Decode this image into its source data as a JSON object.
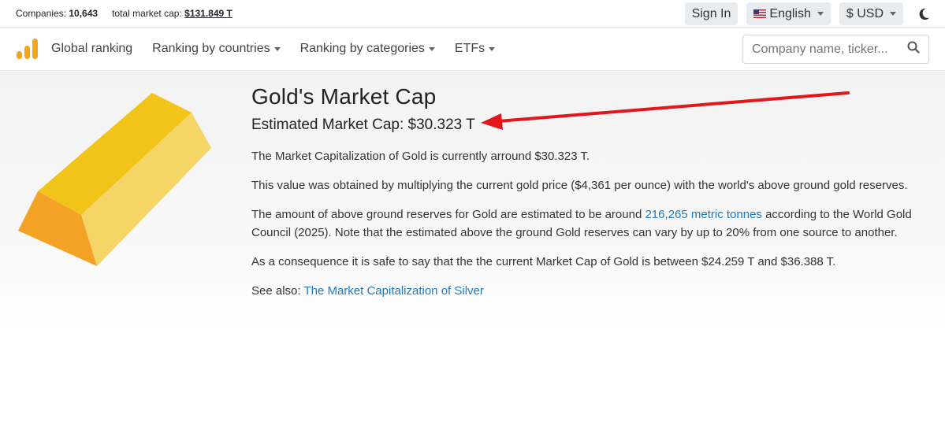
{
  "topbar": {
    "companies_label": "Companies:",
    "companies_value": "10,643",
    "total_cap_label": "total market cap:",
    "total_cap_value": "$131.849 T",
    "signin_label": "Sign In",
    "language_label": "English",
    "currency_label": "$ USD",
    "theme_icon": "moon-icon"
  },
  "nav": {
    "logo_icon": "bar-chart-logo",
    "items": [
      {
        "label": "Global ranking"
      },
      {
        "label": "Ranking by countries"
      },
      {
        "label": "Ranking by categories"
      },
      {
        "label": "ETFs"
      }
    ],
    "search_placeholder": "Company name, ticker...",
    "search_icon": "search-icon"
  },
  "content": {
    "title": "Gold's Market Cap",
    "subtitle": "Estimated Market Cap: $30.323 T",
    "p1": "The Market Capitalization of Gold is currently arround $30.323 T.",
    "p2": "This value was obtained by multiplying the current gold price ($4,361 per ounce) with the world's above ground gold reserves.",
    "p3_before": "The amount of above ground reserves for Gold are estimated to be around ",
    "p3_link": "216,265 metric tonnes",
    "p3_after": " according to the World Gold Council (2025). Note that the estimated above the ground Gold reserves can vary by up to 20% from one source to another.",
    "p4": "As a consequence it is safe to say that the the current Market Cap of Gold is between $24.259 T and $36.388 T.",
    "see_also_label": "See also: ",
    "see_also_link": "The Market Capitalization of Silver"
  },
  "colors": {
    "accent": "#f4a61b",
    "link": "#1a7bc4",
    "arrow": "#e3161b"
  }
}
